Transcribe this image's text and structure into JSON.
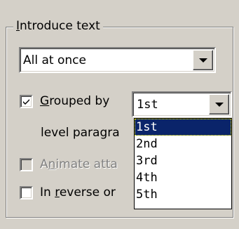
{
  "group": {
    "title_prefix": "",
    "title_accel": "I",
    "title_rest": "ntroduce text"
  },
  "introduce_combo": {
    "value": "All at once"
  },
  "grouped_by": {
    "checked": true,
    "label_accel": "G",
    "label_rest": "rouped by",
    "level_value": "1st",
    "label_line2": "level paragra"
  },
  "animate": {
    "checked": false,
    "enabled": false,
    "label_pre": "A",
    "label_accel": "n",
    "label_rest": "imate atta"
  },
  "reverse": {
    "checked": false,
    "label_pre": "In ",
    "label_accel": "r",
    "label_rest": "everse or"
  },
  "level_dropdown": {
    "options": [
      "1st",
      "2nd",
      "3rd",
      "4th",
      "5th"
    ],
    "selected_index": 0
  }
}
